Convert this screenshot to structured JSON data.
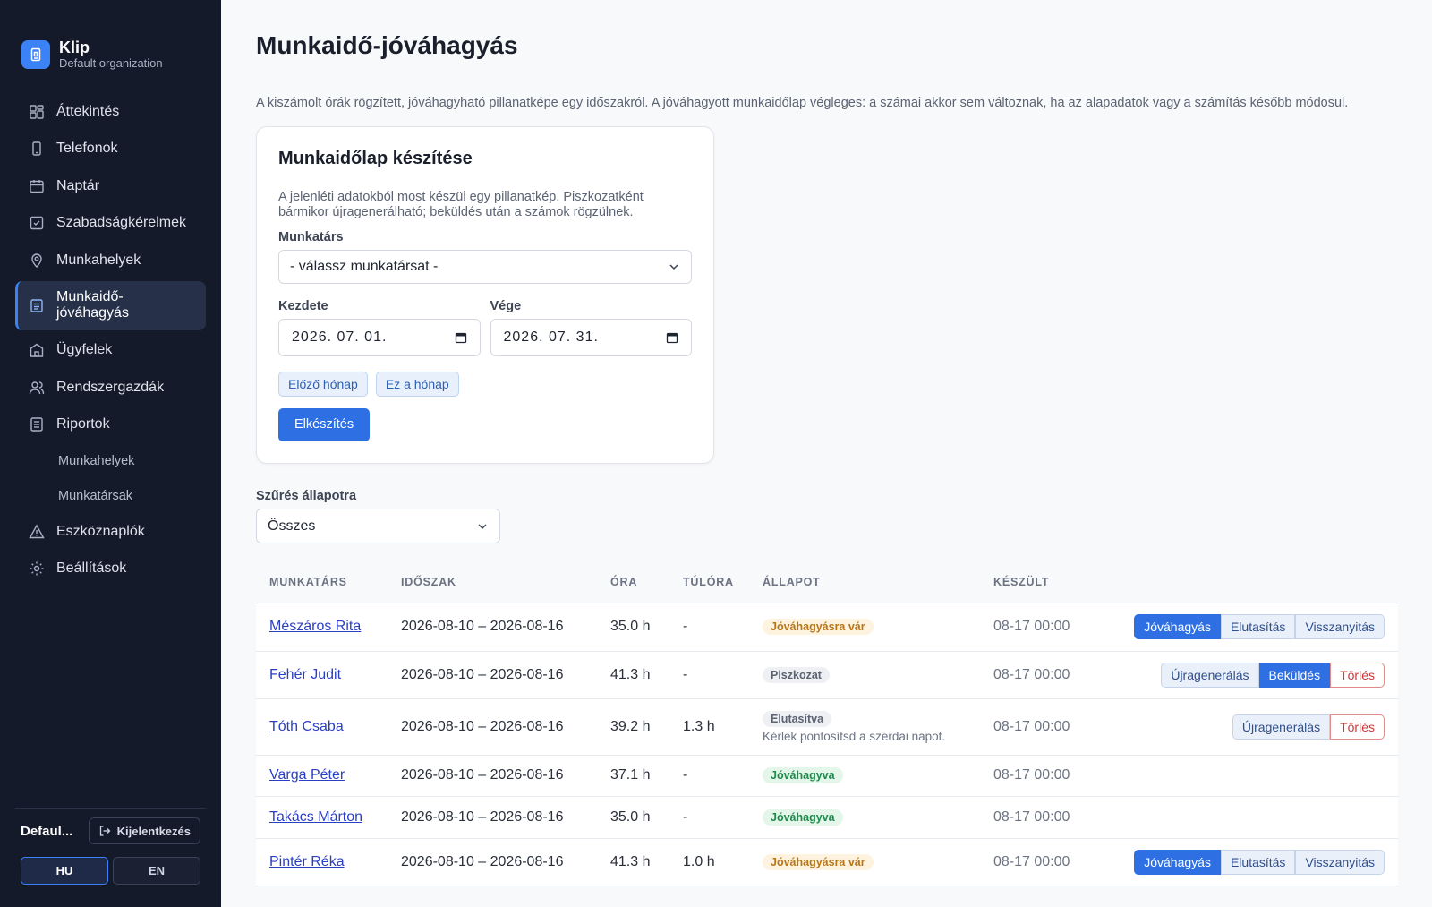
{
  "brand": {
    "name": "Klip",
    "org": "Default organization"
  },
  "nav": [
    {
      "label": "Áttekintés",
      "icon": "dashboard-icon"
    },
    {
      "label": "Telefonok",
      "icon": "phone-icon"
    },
    {
      "label": "Naptár",
      "icon": "calendar-icon"
    },
    {
      "label": "Szabadságkérelmek",
      "icon": "check-square-icon"
    },
    {
      "label": "Munkahelyek",
      "icon": "map-pin-icon"
    },
    {
      "label": "Munkaidő-jóváhagyás",
      "icon": "clipboard-icon",
      "active": true
    },
    {
      "label": "Ügyfelek",
      "icon": "building-icon"
    },
    {
      "label": "Rendszergazdák",
      "icon": "users-icon"
    },
    {
      "label": "Riportok",
      "icon": "report-icon"
    }
  ],
  "nav_sub": [
    "Munkahelyek",
    "Munkatársak"
  ],
  "nav_bottom": [
    {
      "label": "Eszköznaplók",
      "icon": "warning-icon"
    },
    {
      "label": "Beállítások",
      "icon": "gear-icon"
    }
  ],
  "footer": {
    "user": "Defaul...",
    "logout": "Kijelentkezés",
    "lang_hu": "HU",
    "lang_en": "EN"
  },
  "page": {
    "title": "Munkaidő-jóváhagyás",
    "intro": "A kiszámolt órák rögzített, jóváhagyható pillanatképe egy időszakról. A jóváhagyott munkaidőlap végleges: a számai akkor sem változnak, ha az alapadatok vagy a számítás később módosul."
  },
  "form": {
    "title": "Munkaidőlap készítése",
    "desc": "A jelenléti adatokból most készül egy pillanatkép. Piszkozatként bármikor újragenerálható; beküldés után a számok rögzülnek.",
    "employee_label": "Munkatárs",
    "employee_value": "- válassz munkatársat -",
    "start_label": "Kezdete",
    "start_value": "2026. 07. 01.",
    "end_label": "Vége",
    "end_value": "2026. 07. 31.",
    "prev_month": "Előző hónap",
    "this_month": "Ez a hónap",
    "submit": "Elkészítés"
  },
  "filter": {
    "label": "Szűrés állapotra",
    "value": "Összes"
  },
  "table": {
    "headers": [
      "MUNKATÁRS",
      "IDŐSZAK",
      "ÓRA",
      "TÚLÓRA",
      "ÁLLAPOT",
      "KÉSZÜLT"
    ],
    "rows": [
      {
        "name": "Mészáros Rita",
        "period": "2026-08-10 – 2026-08-16",
        "hours": "35.0 h",
        "overtime": "-",
        "status": "Jóváhagyásra vár",
        "status_kind": "pending",
        "reason": "",
        "created": "08-17 00:00",
        "actions": [
          "Jóváhagyás",
          "Elutasítás",
          "Visszanyitás"
        ]
      },
      {
        "name": "Fehér Judit",
        "period": "2026-08-10 – 2026-08-16",
        "hours": "41.3 h",
        "overtime": "-",
        "status": "Piszkozat",
        "status_kind": "draft",
        "reason": "",
        "created": "08-17 00:00",
        "actions": [
          "Újragenerálás",
          "Beküldés",
          "Törlés"
        ]
      },
      {
        "name": "Tóth Csaba",
        "period": "2026-08-10 – 2026-08-16",
        "hours": "39.2 h",
        "overtime": "1.3 h",
        "status": "Elutasítva",
        "status_kind": "rejected",
        "reason": "Kérlek pontosítsd a szerdai napot.",
        "created": "08-17 00:00",
        "actions": [
          "Újragenerálás",
          "Törlés"
        ]
      },
      {
        "name": "Varga Péter",
        "period": "2026-08-10 – 2026-08-16",
        "hours": "37.1 h",
        "overtime": "-",
        "status": "Jóváhagyva",
        "status_kind": "approved",
        "reason": "",
        "created": "08-17 00:00",
        "actions": []
      },
      {
        "name": "Takács Márton",
        "period": "2026-08-10 – 2026-08-16",
        "hours": "35.0 h",
        "overtime": "-",
        "status": "Jóváhagyva",
        "status_kind": "approved",
        "reason": "",
        "created": "08-17 00:00",
        "actions": []
      },
      {
        "name": "Pintér Réka",
        "period": "2026-08-10 – 2026-08-16",
        "hours": "41.3 h",
        "overtime": "1.0 h",
        "status": "Jóváhagyásra vár",
        "status_kind": "pending",
        "reason": "",
        "created": "08-17 00:00",
        "actions": [
          "Jóváhagyás",
          "Elutasítás",
          "Visszanyitás"
        ]
      }
    ]
  },
  "colors": {
    "sidebar": "#151a2b",
    "accent": "#2f6fe4",
    "active_nav": "#263149"
  }
}
